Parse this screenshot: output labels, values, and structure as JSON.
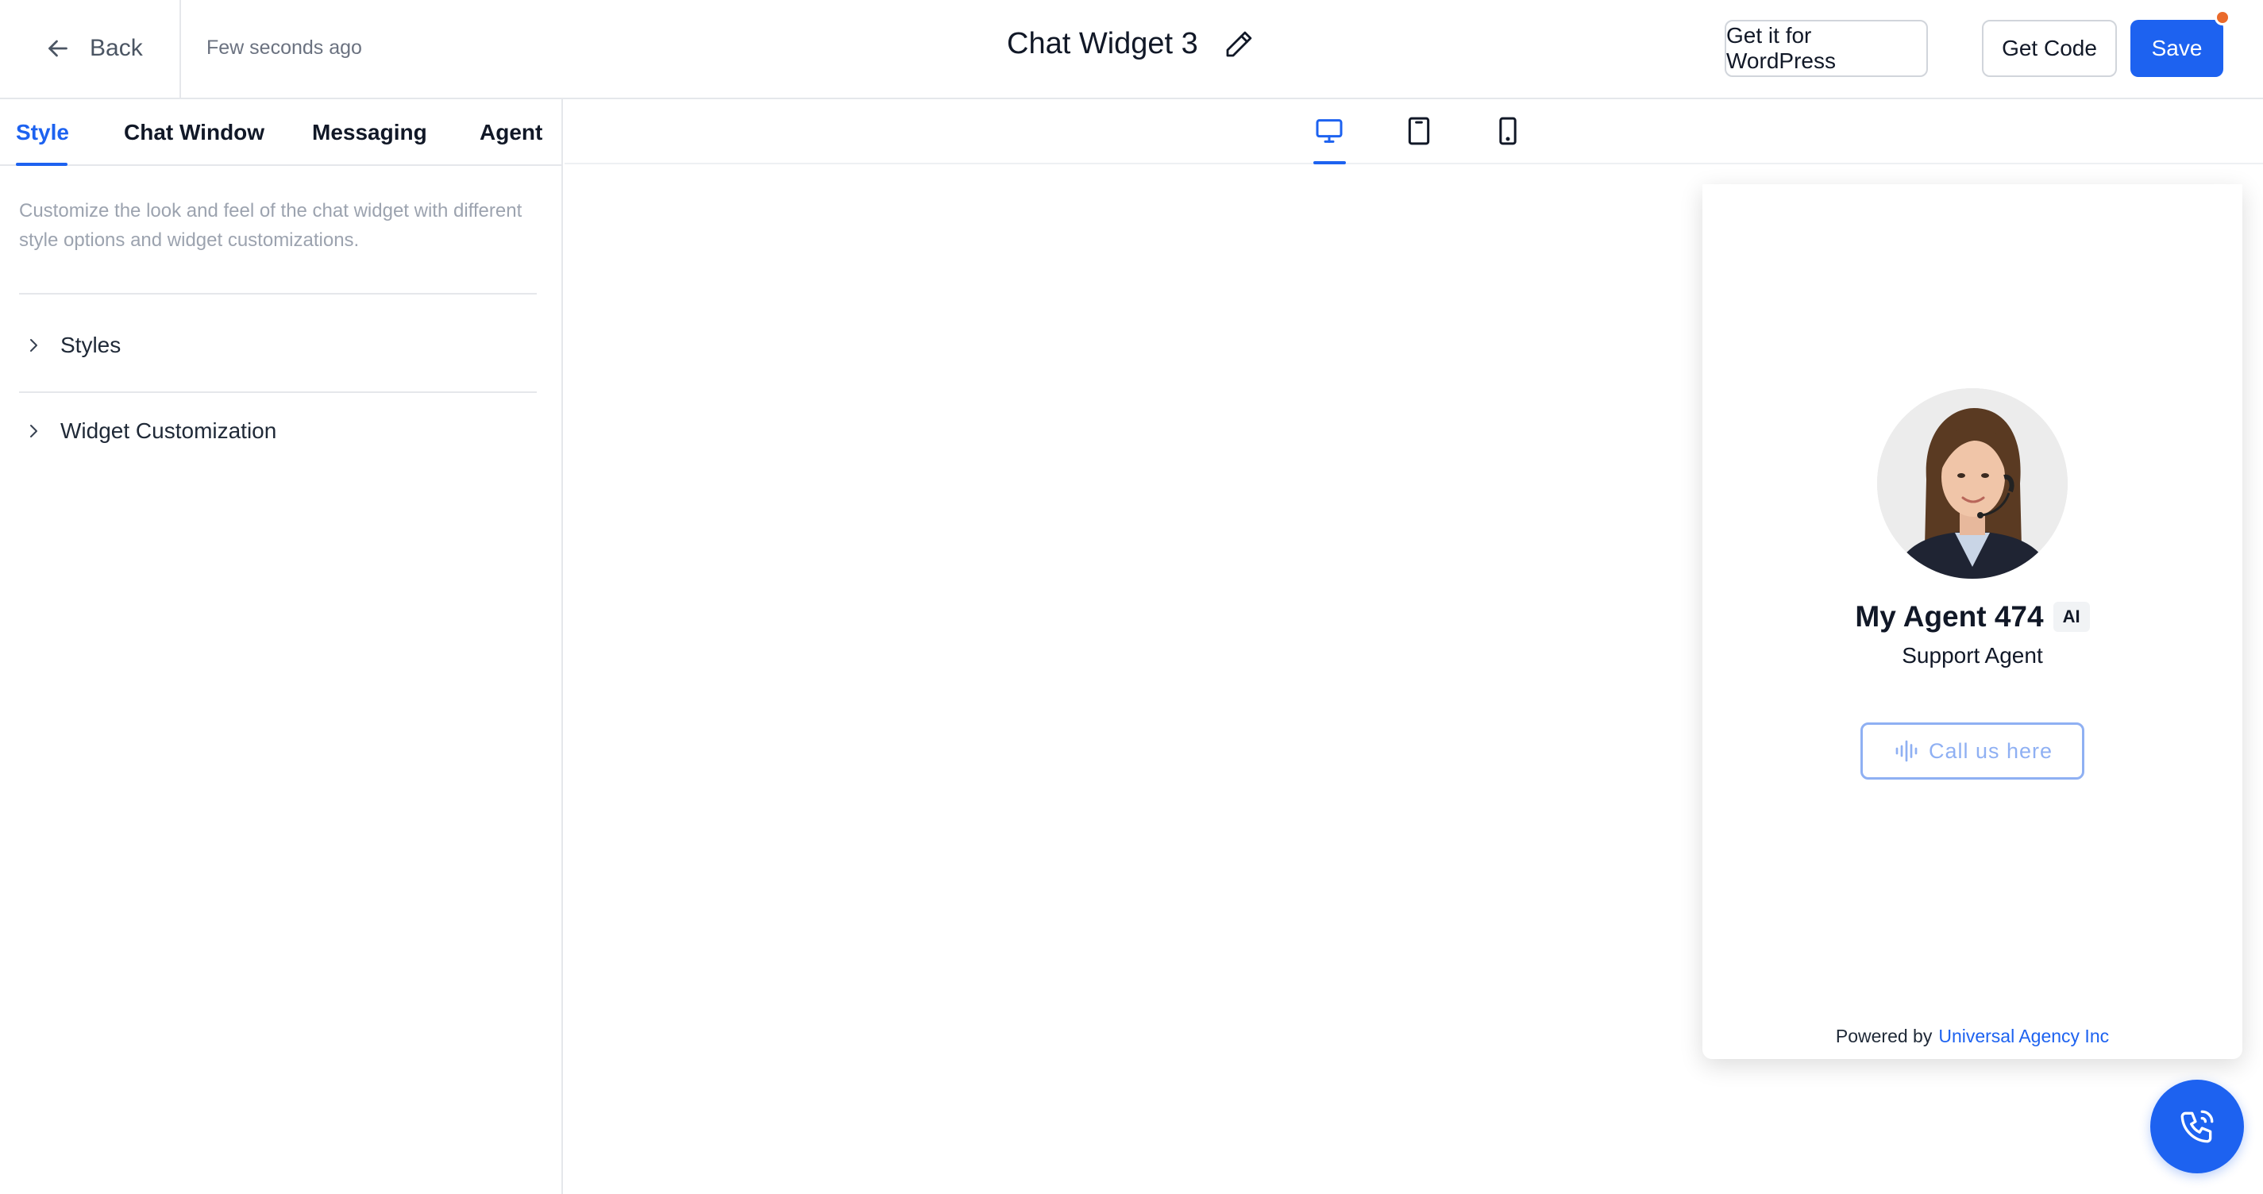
{
  "header": {
    "back_label": "Back",
    "saved_status": "Few seconds ago",
    "widget_title": "Chat Widget 3",
    "wordpress_button": "Get it for WordPress",
    "get_code_button": "Get Code",
    "save_button": "Save"
  },
  "left_panel": {
    "tabs": [
      {
        "label": "Style",
        "active": true
      },
      {
        "label": "Chat Window",
        "active": false
      },
      {
        "label": "Messaging",
        "active": false
      },
      {
        "label": "Agent",
        "active": false
      }
    ],
    "description": "Customize the look and feel of the chat widget with different style options and widget customizations.",
    "sections": [
      {
        "label": "Styles"
      },
      {
        "label": "Widget Customization"
      }
    ]
  },
  "device_toolbar": {
    "devices": [
      "desktop-icon",
      "tablet-icon",
      "mobile-icon"
    ],
    "selected": "desktop"
  },
  "preview": {
    "agent_name": "My Agent 474",
    "agent_badge": "AI",
    "agent_role": "Support Agent",
    "call_button": "Call us here",
    "powered_by_label": "Powered by",
    "powered_by_brand": "Universal Agency Inc"
  },
  "colors": {
    "primary": "#1d62f0",
    "notification": "#ea6a2b",
    "call_button_outline": "#8fb0f3"
  }
}
